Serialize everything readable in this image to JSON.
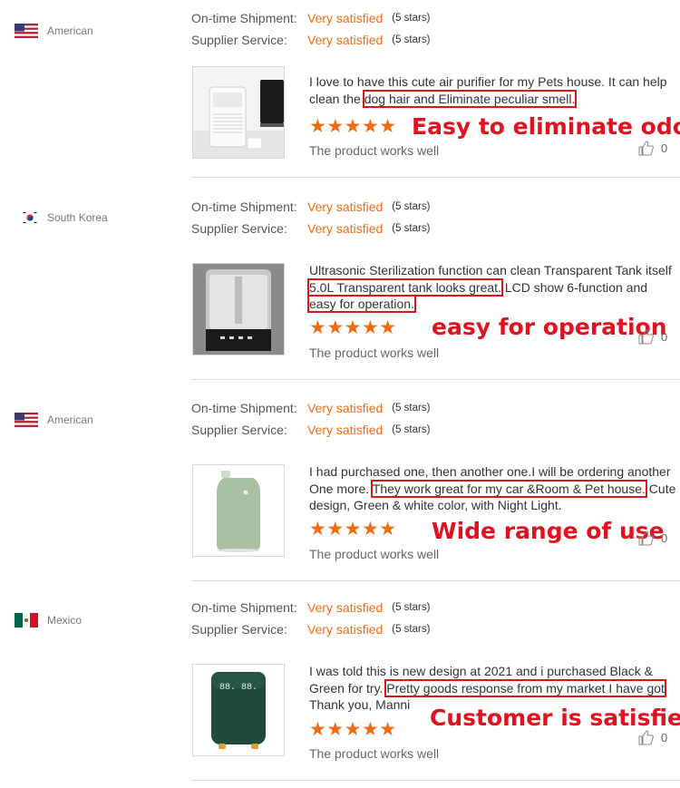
{
  "rating_labels": {
    "shipment": "On-time Shipment:",
    "supplier": "Supplier Service:"
  },
  "reviews": [
    {
      "country": "American",
      "flag": "us-flag",
      "shipment_value": "Very satisfied",
      "shipment_stars": "(5 stars)",
      "supplier_value": "Very satisfied",
      "supplier_stars": "(5 stars)",
      "text_before": "I love to have this cute air purifier for my Pets house. It can help clean the ",
      "text_highlight": "dog hair and Eliminate peculiar smell.",
      "text_after": "",
      "stars": "★★★★★",
      "rating": 5,
      "annotation": "Easy to eliminate odors",
      "works": "The product works well",
      "likes": "0"
    },
    {
      "country": "South Korea",
      "flag": "kr-flag",
      "shipment_value": "Very satisfied",
      "shipment_stars": "(5 stars)",
      "supplier_value": "Very satisfied",
      "supplier_stars": "(5 stars)",
      "text_before": "Ultrasonic Sterilization function can clean Transparent Tank itself ",
      "text_highlight": "5.0L Transparent tank looks great.",
      "text_after": " LCD show 6-function  and ",
      "text_highlight2": "easy for operation.",
      "stars": "★★★★★",
      "rating": 5,
      "annotation": "easy for operation",
      "works": "The product works well",
      "likes": "0"
    },
    {
      "country": "American",
      "flag": "us-flag",
      "shipment_value": "Very satisfied",
      "shipment_stars": "(5 stars)",
      "supplier_value": "Very satisfied",
      "supplier_stars": "(5 stars)",
      "text_before": "I had purchased one, then another one.I will be ordering another One more. ",
      "text_highlight": "They work great for my car &Room & Pet house.",
      "text_after": " Cute design, Green & white color, with Night Light.",
      "stars": "★★★★★",
      "rating": 5,
      "annotation": "Wide range of use",
      "works": "The product works well",
      "likes": "0"
    },
    {
      "country": "Mexico",
      "flag": "mx-flag",
      "shipment_value": "Very satisfied",
      "shipment_stars": "(5 stars)",
      "supplier_value": "Very satisfied",
      "supplier_stars": "(5 stars)",
      "text_before": "I was told this is new design at 2021 and i purchased Black & Green for try. ",
      "text_highlight": "Pretty goods response from my market I have got",
      "text_after": " Thank you, Manni",
      "stars": "★★★★★",
      "rating": 5,
      "annotation": "Customer is satisfied",
      "works": "The product works well",
      "likes": "0"
    }
  ],
  "product_display": {
    "humidifier_readout": "88. 88."
  },
  "colors": {
    "accent_orange": "#f26b11",
    "annotation_red": "#e0121f",
    "highlight_box": "#d11a1a"
  }
}
